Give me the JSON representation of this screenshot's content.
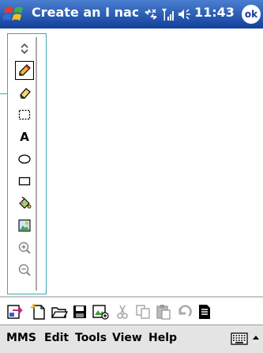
{
  "app": {
    "title": "Create an I nac"
  },
  "status": {
    "time": "11:43",
    "ok_label": "ok"
  },
  "toolbox": {
    "tools": [
      {
        "name": "collapse"
      },
      {
        "name": "pencil",
        "selected": true
      },
      {
        "name": "eraser"
      },
      {
        "name": "select"
      },
      {
        "name": "text",
        "glyph": "A"
      },
      {
        "name": "ellipse"
      },
      {
        "name": "rectangle"
      },
      {
        "name": "fill"
      },
      {
        "name": "insert-picture"
      },
      {
        "name": "zoom-in"
      },
      {
        "name": "zoom-out"
      }
    ]
  },
  "menu": {
    "items": [
      "MMS",
      "Edit",
      "Tools",
      "View",
      "Help"
    ]
  },
  "colors": {
    "accent": "#3aaab0",
    "titlebar": "#1d4fa6"
  }
}
